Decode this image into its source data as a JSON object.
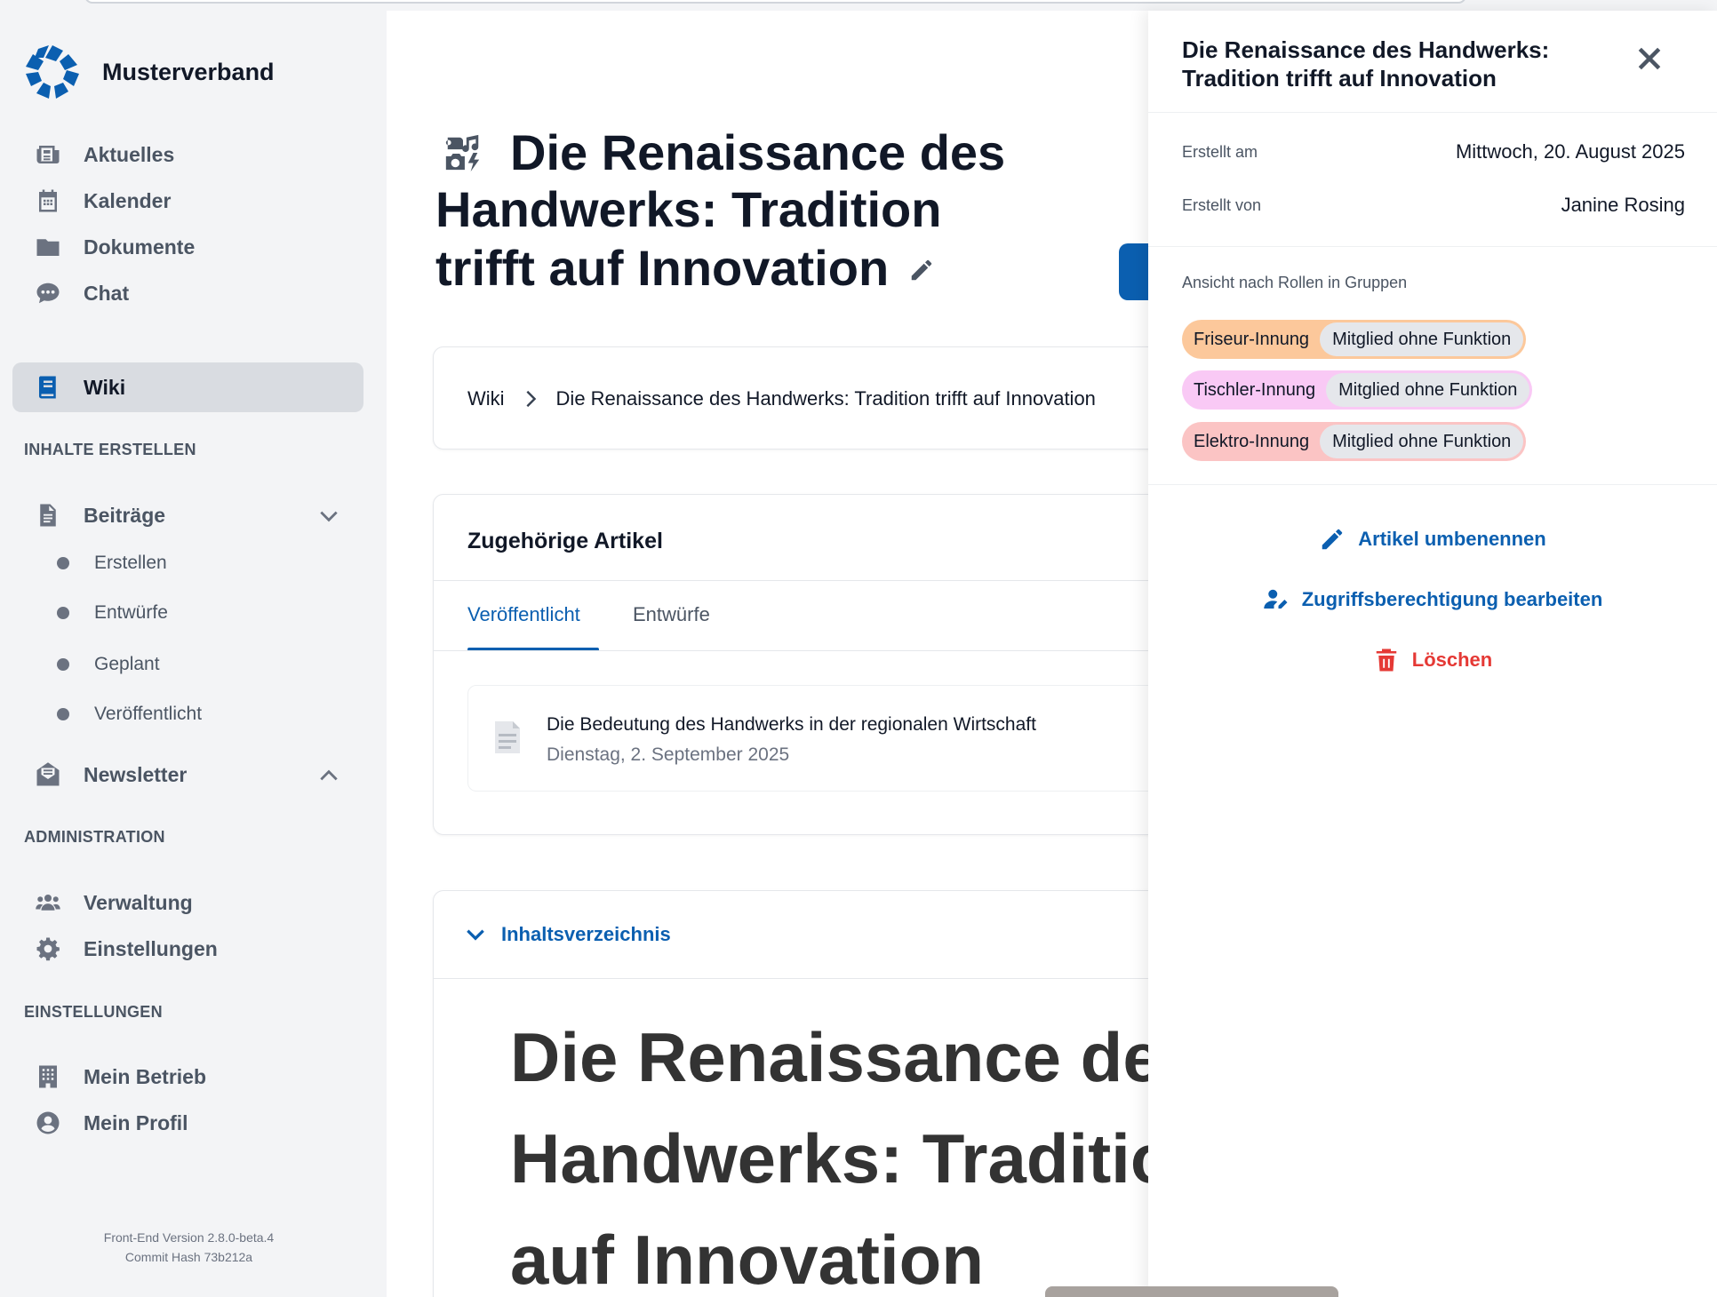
{
  "app": {
    "brand": "Musterverband",
    "colors": {
      "accent": "#0b5fb0",
      "danger": "#e53935"
    }
  },
  "sidebar": {
    "nav": [
      {
        "label": "Aktuelles",
        "icon": "newspaper-icon"
      },
      {
        "label": "Kalender",
        "icon": "calendar-icon"
      },
      {
        "label": "Dokumente",
        "icon": "folder-icon"
      },
      {
        "label": "Chat",
        "icon": "chat-icon"
      },
      {
        "label": "Wiki",
        "icon": "book-icon",
        "active": true
      }
    ],
    "section_create": "INHALTE ERSTELLEN",
    "beitraege": {
      "label": "Beiträge",
      "sub": [
        "Erstellen",
        "Entwürfe",
        "Geplant",
        "Veröffentlicht"
      ]
    },
    "newsletter": {
      "label": "Newsletter"
    },
    "section_admin": "ADMINISTRATION",
    "admin": [
      {
        "label": "Verwaltung",
        "icon": "users-icon"
      },
      {
        "label": "Einstellungen",
        "icon": "gear-icon"
      }
    ],
    "section_settings": "EINSTELLUNGEN",
    "settings": [
      {
        "label": "Mein Betrieb",
        "icon": "building-icon"
      },
      {
        "label": "Mein Profil",
        "icon": "user-circle-icon"
      }
    ],
    "version": "Front-End Version 2.8.0-beta.4",
    "commit": "Commit Hash 73b212a"
  },
  "main": {
    "title": "Die Renaissance des Handwerks: Tradition trifft auf Innovation",
    "breadcrumb": {
      "root": "Wiki",
      "current": "Die Renaissance des Handwerks: Tradition trifft auf Innovation"
    },
    "related": {
      "header": "Zugehörige Artikel",
      "tabs": [
        "Veröffentlicht",
        "Entwürfe"
      ],
      "items": [
        {
          "title": "Die Bedeutung des Handwerks in der regionalen Wirtschaft",
          "date": "Dienstag, 2. September 2025"
        }
      ]
    },
    "toc": {
      "label": "Inhaltsverzeichnis",
      "heading": "Die Renaissance des Handwerks: Tradition trifft auf Innovation"
    }
  },
  "drawer": {
    "title": "Die Renaissance des Handwerks: Tradition trifft auf Innovation",
    "created_at_label": "Erstellt am",
    "created_at": "Mittwoch, 20. August 2025",
    "created_by_label": "Erstellt von",
    "created_by": "Janine Rosing",
    "roles_label": "Ansicht nach Rollen in Gruppen",
    "roles": [
      {
        "group": "Friseur-Innung",
        "role": "Mitglied ohne Funktion",
        "color": "#fcc89b"
      },
      {
        "group": "Tischler-Innung",
        "role": "Mitglied ohne Funktion",
        "color": "#f9c9f5"
      },
      {
        "group": "Elektro-Innung",
        "role": "Mitglied ohne Funktion",
        "color": "#fbc4c4"
      }
    ],
    "actions": {
      "rename": "Artikel umbenennen",
      "permissions": "Zugriffsberechtigung bearbeiten",
      "delete": "Löschen"
    }
  }
}
